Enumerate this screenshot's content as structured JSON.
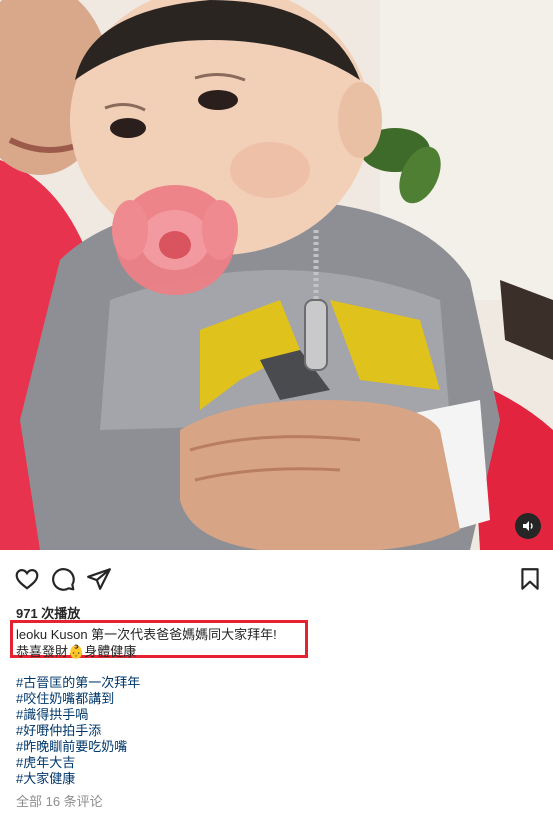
{
  "post": {
    "media_alt": "Toddler in grey and yellow hoodie with pink pacifier held by an adult",
    "sound_icon": "speaker-icon",
    "actions": {
      "like_icon": "heart-icon",
      "comment_icon": "comment-bubble-icon",
      "share_icon": "paper-plane-icon",
      "save_icon": "bookmark-icon"
    },
    "plays": "971 次播放",
    "caption": {
      "username": "leoku",
      "line1": "Kuson 第一次代表爸爸媽媽同大家拜年!",
      "line2_prefix": "恭喜發財",
      "line2_emoji": "👶",
      "line2_suffix": "身體健康"
    },
    "hashtags": [
      "#古晉匡的第一次拜年",
      "#咬住奶嘴都講到",
      "#識得拱手喎",
      "#好嘢仲拍手添",
      "#昨晚瞓前要吃奶嘴",
      "#虎年大吉",
      "#大家健康"
    ],
    "comments_link": "全部 16 条评论"
  },
  "colors": {
    "highlight_box": "#e52330",
    "hashtag": "#00376b",
    "muted": "#8e8e8e",
    "text": "#262626"
  }
}
